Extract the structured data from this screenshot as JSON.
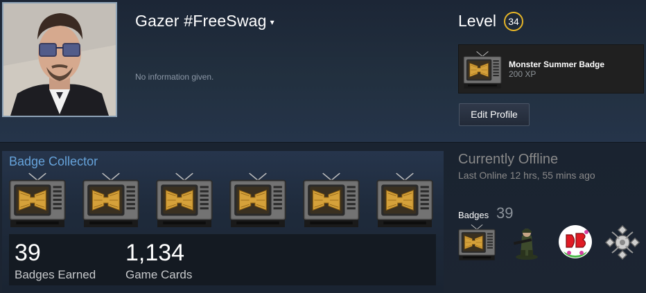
{
  "profile": {
    "persona_name": "Gazer #FreeSwag",
    "caret": "▾",
    "summary": "No information given.",
    "level_label": "Level",
    "level": "34",
    "favorite_badge": {
      "name": "Monster Summer Badge",
      "xp": "200 XP"
    },
    "edit_button": "Edit Profile"
  },
  "showcase": {
    "title": "Badge Collector",
    "badges": [
      "tv-badge-icon",
      "tv-badge-icon",
      "tv-badge-icon",
      "tv-badge-icon",
      "tv-badge-icon",
      "tv-badge-icon"
    ],
    "stats": [
      {
        "value": "39",
        "label": "Badges Earned"
      },
      {
        "value": "1,134",
        "label": "Game Cards"
      }
    ]
  },
  "sidebar": {
    "status": "Currently Offline",
    "last_online": "Last Online 12 hrs, 55 mins ago",
    "badges_label": "Badges",
    "badges_count": "39",
    "badge_icons": [
      "tv-badge-icon",
      "soldier-badge-icon",
      "db-badge-icon",
      "gamepad-badge-icon"
    ]
  },
  "colors": {
    "accent_blue": "#66a3db",
    "level_ring": "#e6b527",
    "background": "#1b2433"
  }
}
